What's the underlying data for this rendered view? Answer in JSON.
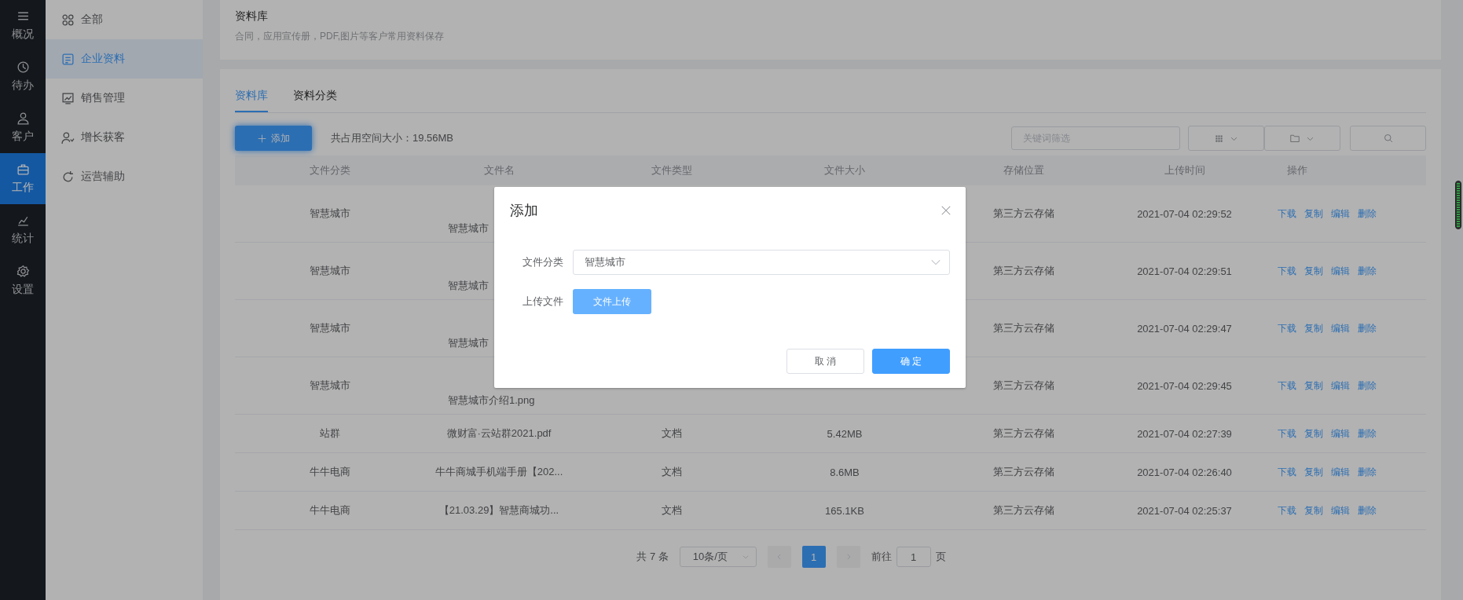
{
  "rail": {
    "items": [
      {
        "label": "概况",
        "selected": false
      },
      {
        "label": "待办",
        "selected": false
      },
      {
        "label": "客户",
        "selected": false
      },
      {
        "label": "工作",
        "selected": true
      },
      {
        "label": "统计",
        "selected": false
      },
      {
        "label": "设置",
        "selected": false
      }
    ]
  },
  "sidebar": {
    "items": [
      {
        "label": "全部",
        "selected": false
      },
      {
        "label": "企业资料",
        "selected": true
      },
      {
        "label": "销售管理",
        "selected": false
      },
      {
        "label": "增长获客",
        "selected": false
      },
      {
        "label": "运营辅助",
        "selected": false
      }
    ]
  },
  "header": {
    "title": "资料库",
    "subtitle": "合同，应用宣传册，PDF,图片等客户常用资料保存"
  },
  "tabs": [
    {
      "label": "资料库",
      "selected": true
    },
    {
      "label": "资料分类",
      "selected": false
    }
  ],
  "toolbar": {
    "add_button": "添加",
    "storage_text": "共占用空间大小：19.56MB",
    "search": {
      "placeholder": "关键词筛选"
    }
  },
  "table": {
    "columns": [
      "文件分类",
      "文件名",
      "文件类型",
      "文件大小",
      "存储位置",
      "上传时间",
      "操作"
    ],
    "rows": [
      {
        "kind": "image",
        "category": "智慧城市",
        "name": "智慧城市",
        "location": "第三方云存储",
        "time": "2021-07-04 02:29:52",
        "actions": [
          "下载",
          "复制",
          "编辑",
          "删除"
        ]
      },
      {
        "kind": "image",
        "category": "智慧城市",
        "name": "智慧城市",
        "location": "第三方云存储",
        "time": "2021-07-04 02:29:51",
        "actions": [
          "下载",
          "复制",
          "编辑",
          "删除"
        ]
      },
      {
        "kind": "image",
        "category": "智慧城市",
        "name": "智慧城市",
        "location": "第三方云存储",
        "time": "2021-07-04 02:29:47",
        "actions": [
          "下载",
          "复制",
          "编辑",
          "删除"
        ]
      },
      {
        "kind": "image",
        "category": "智慧城市",
        "name": "智慧城市介绍1.png",
        "location": "第三方云存储",
        "time": "2021-07-04 02:29:45",
        "actions": [
          "下载",
          "复制",
          "编辑",
          "删除"
        ]
      },
      {
        "kind": "file",
        "category": "站群",
        "name": "微财富·云站群2021.pdf",
        "type": "文档",
        "size": "5.42MB",
        "location": "第三方云存储",
        "time": "2021-07-04 02:27:39",
        "actions": [
          "下载",
          "复制",
          "编辑",
          "删除"
        ]
      },
      {
        "kind": "file",
        "category": "牛牛电商",
        "name": "牛牛商城手机端手册【202...",
        "type": "文档",
        "size": "8.6MB",
        "location": "第三方云存储",
        "time": "2021-07-04 02:26:40",
        "actions": [
          "下载",
          "复制",
          "编辑",
          "删除"
        ]
      },
      {
        "kind": "file",
        "category": "牛牛电商",
        "name": "【21.03.29】智慧商城功...",
        "type": "文档",
        "size": "165.1KB",
        "location": "第三方云存储",
        "time": "2021-07-04 02:25:37",
        "actions": [
          "下载",
          "复制",
          "编辑",
          "删除"
        ]
      }
    ]
  },
  "pagination": {
    "total": "共 7 条",
    "page_size": "10条/页",
    "pages": [
      {
        "label": "1",
        "selected": true
      }
    ],
    "goto_label": "前往",
    "goto_value": "1",
    "page_unit": "页"
  },
  "dialog": {
    "title": "添加",
    "fields": [
      {
        "kind": "select",
        "label": "文件分类",
        "value": "智慧城市"
      },
      {
        "kind": "upload",
        "label": "上传文件",
        "button": "文件上传"
      }
    ],
    "buttons": [
      {
        "kind": "cancel",
        "label": "取 消"
      },
      {
        "kind": "confirm",
        "label": "确 定"
      }
    ]
  }
}
